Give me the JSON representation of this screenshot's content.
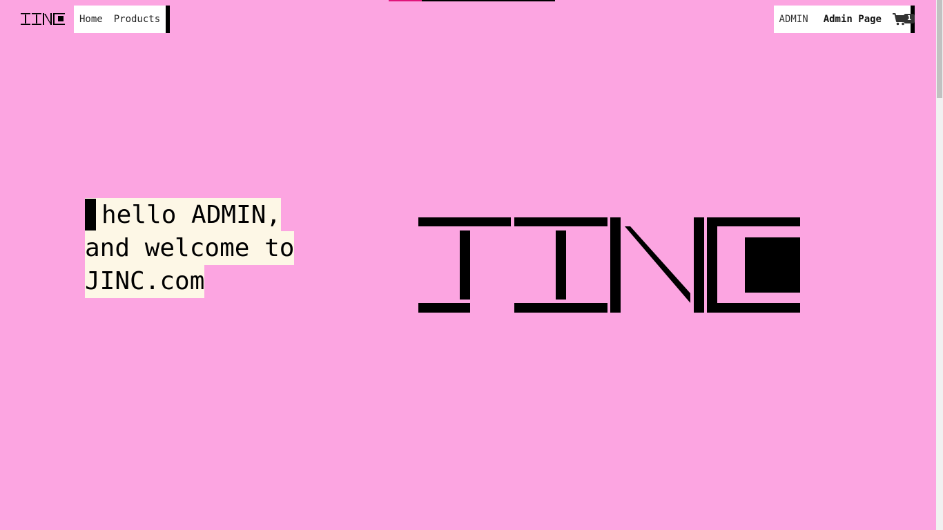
{
  "brand": {
    "logo_text": "JINC"
  },
  "nav": {
    "home_label": "Home",
    "products_label": "Products"
  },
  "user_menu": {
    "username": "ADMIN",
    "admin_link_label": "Admin Page",
    "cart_count": "1"
  },
  "hero": {
    "greeting": "hello ADMIN, and welcome to JINC.com"
  },
  "colors": {
    "background": "#fca5e1",
    "highlight": "#fdf7e6",
    "accent": "#e0157b"
  },
  "icons": [
    "cart-icon"
  ]
}
